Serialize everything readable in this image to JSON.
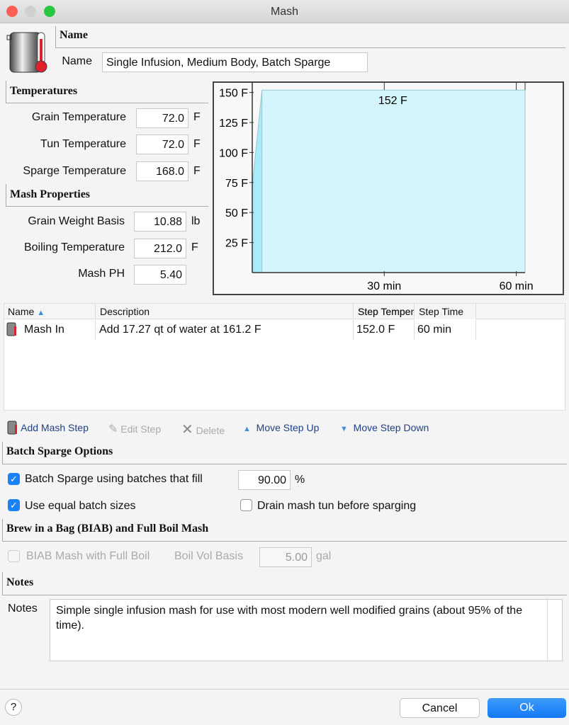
{
  "window": {
    "title": "Mash"
  },
  "name_section": {
    "header": "Name",
    "label": "Name",
    "value": "Single Infusion, Medium Body, Batch Sparge"
  },
  "temperatures": {
    "header": "Temperatures",
    "grain": {
      "label": "Grain Temperature",
      "value": "72.0",
      "unit": "F"
    },
    "tun": {
      "label": "Tun Temperature",
      "value": "72.0",
      "unit": "F"
    },
    "sparge": {
      "label": "Sparge Temperature",
      "value": "168.0",
      "unit": "F"
    }
  },
  "mash_properties": {
    "header": "Mash Properties",
    "grain_weight": {
      "label": "Grain Weight Basis",
      "value": "10.88",
      "unit": "lb"
    },
    "boiling": {
      "label": "Boiling Temperature",
      "value": "212.0",
      "unit": "F"
    },
    "ph": {
      "label": "Mash PH",
      "value": "5.40"
    }
  },
  "chart_data": {
    "type": "area",
    "x": [
      0,
      2.2,
      62
    ],
    "y": [
      72,
      152,
      152
    ],
    "xlim": [
      0,
      62
    ],
    "ylim": [
      0,
      160
    ],
    "xticks": [
      {
        "value": 30,
        "label": "30 min"
      },
      {
        "value": 60,
        "label": "60 min"
      }
    ],
    "yticks": [
      {
        "value": 25,
        "label": "25 F"
      },
      {
        "value": 50,
        "label": "50 F"
      },
      {
        "value": 75,
        "label": "75 F"
      },
      {
        "value": 100,
        "label": "100 F"
      },
      {
        "value": 125,
        "label": "125 F"
      },
      {
        "value": 150,
        "label": "150 F"
      }
    ],
    "annotations": [
      {
        "x": 30,
        "y": 152,
        "label": "152 F"
      }
    ],
    "fill_color": "#d3f5fb",
    "ramp_color": "#a8ecfb"
  },
  "steps_table": {
    "columns": [
      "Name",
      "Description",
      "Step Temperature",
      "Step Time"
    ],
    "column_display": [
      "Name",
      "Description",
      "Step Tempe",
      "Step Time"
    ],
    "rows": [
      {
        "name": "Mash In",
        "description": "Add 17.27 qt of water at 161.2 F",
        "temp": "152.0 F",
        "time": "60 min"
      }
    ]
  },
  "toolbar": {
    "add": "Add Mash Step",
    "edit": "Edit Step",
    "delete": "Delete",
    "up": "Move Step Up",
    "down": "Move Step Down"
  },
  "batch_sparge": {
    "header": "Batch Sparge Options",
    "fill_label": "Batch Sparge using batches that fill",
    "fill_checked": true,
    "fill_value": "90.00",
    "fill_unit": "%",
    "equal_label": "Use equal batch sizes",
    "equal_checked": true,
    "drain_label": "Drain mash tun before sparging",
    "drain_checked": false
  },
  "biab": {
    "header": "Brew in a Bag (BIAB) and Full Boil Mash",
    "label": "BIAB Mash with Full Boil",
    "checked": false,
    "vol_label": "Boil Vol Basis",
    "vol_value": "5.00",
    "vol_unit": "gal"
  },
  "notes": {
    "header": "Notes",
    "label": "Notes",
    "value": "Simple single infusion mash for use with most modern well modified grains (about 95% of the time)."
  },
  "buttons": {
    "help": "?",
    "cancel": "Cancel",
    "ok": "Ok"
  },
  "colors": {
    "accent": "#1a82f7"
  }
}
